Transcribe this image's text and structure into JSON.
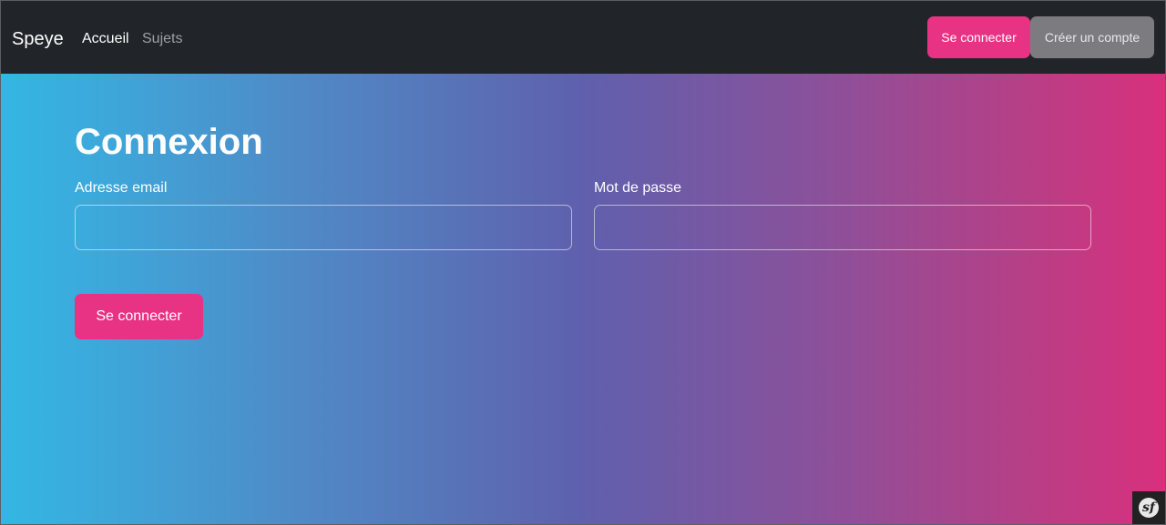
{
  "navbar": {
    "brand": "Speye",
    "links": [
      {
        "label": "Accueil",
        "active": true
      },
      {
        "label": "Sujets",
        "active": false
      }
    ],
    "login_label": "Se connecter",
    "register_label": "Créer un compte"
  },
  "login_form": {
    "title": "Connexion",
    "email_label": "Adresse email",
    "email_value": "",
    "password_label": "Mot de passe",
    "password_value": "",
    "submit_label": "Se connecter"
  },
  "debug_toolbar": {
    "icon": "symfony-logo-icon",
    "glyph": "sf"
  },
  "colors": {
    "accent": "#e83283",
    "navbar_bg": "#212529",
    "secondary_button": "#7c7c80",
    "gradient_start": "#33b7e4",
    "gradient_end": "#d9307d"
  }
}
